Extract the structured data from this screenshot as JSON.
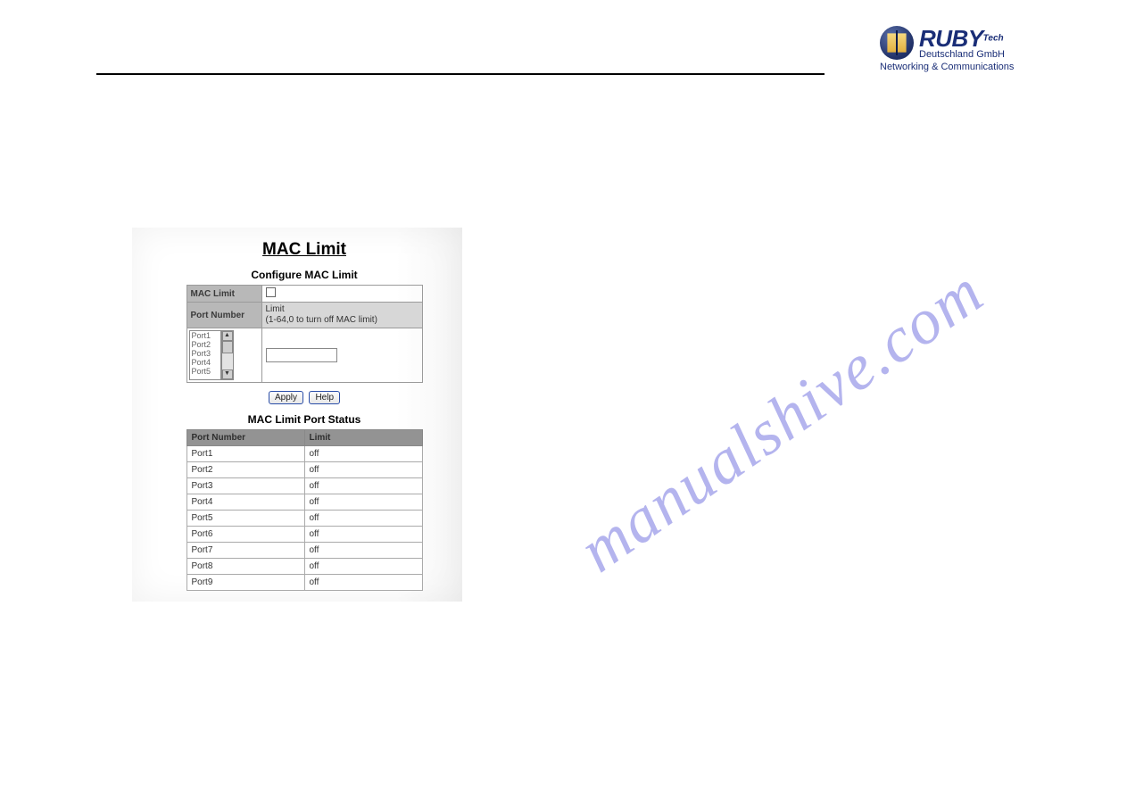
{
  "logo": {
    "main": "RUBY",
    "suffix": "Tech",
    "line1": "Deutschland GmbH",
    "line2": "Networking & Communications"
  },
  "watermark": "manualshive.com",
  "panel": {
    "title": "MAC Limit",
    "configure_title": "Configure MAC Limit",
    "row_mac_limit": "MAC Limit",
    "row_port_number": "Port Number",
    "limit_label_line1": "Limit",
    "limit_label_line2": "(1-64,0 to turn off MAC limit)",
    "port_list": [
      "Port1",
      "Port2",
      "Port3",
      "Port4",
      "Port5"
    ],
    "limit_input_value": "",
    "btn_apply": "Apply",
    "btn_help": "Help",
    "status_title": "MAC Limit Port Status",
    "status_headers": {
      "port": "Port Number",
      "limit": "Limit"
    },
    "status_rows": [
      {
        "port": "Port1",
        "limit": "off"
      },
      {
        "port": "Port2",
        "limit": "off"
      },
      {
        "port": "Port3",
        "limit": "off"
      },
      {
        "port": "Port4",
        "limit": "off"
      },
      {
        "port": "Port5",
        "limit": "off"
      },
      {
        "port": "Port6",
        "limit": "off"
      },
      {
        "port": "Port7",
        "limit": "off"
      },
      {
        "port": "Port8",
        "limit": "off"
      },
      {
        "port": "Port9",
        "limit": "off"
      }
    ]
  }
}
